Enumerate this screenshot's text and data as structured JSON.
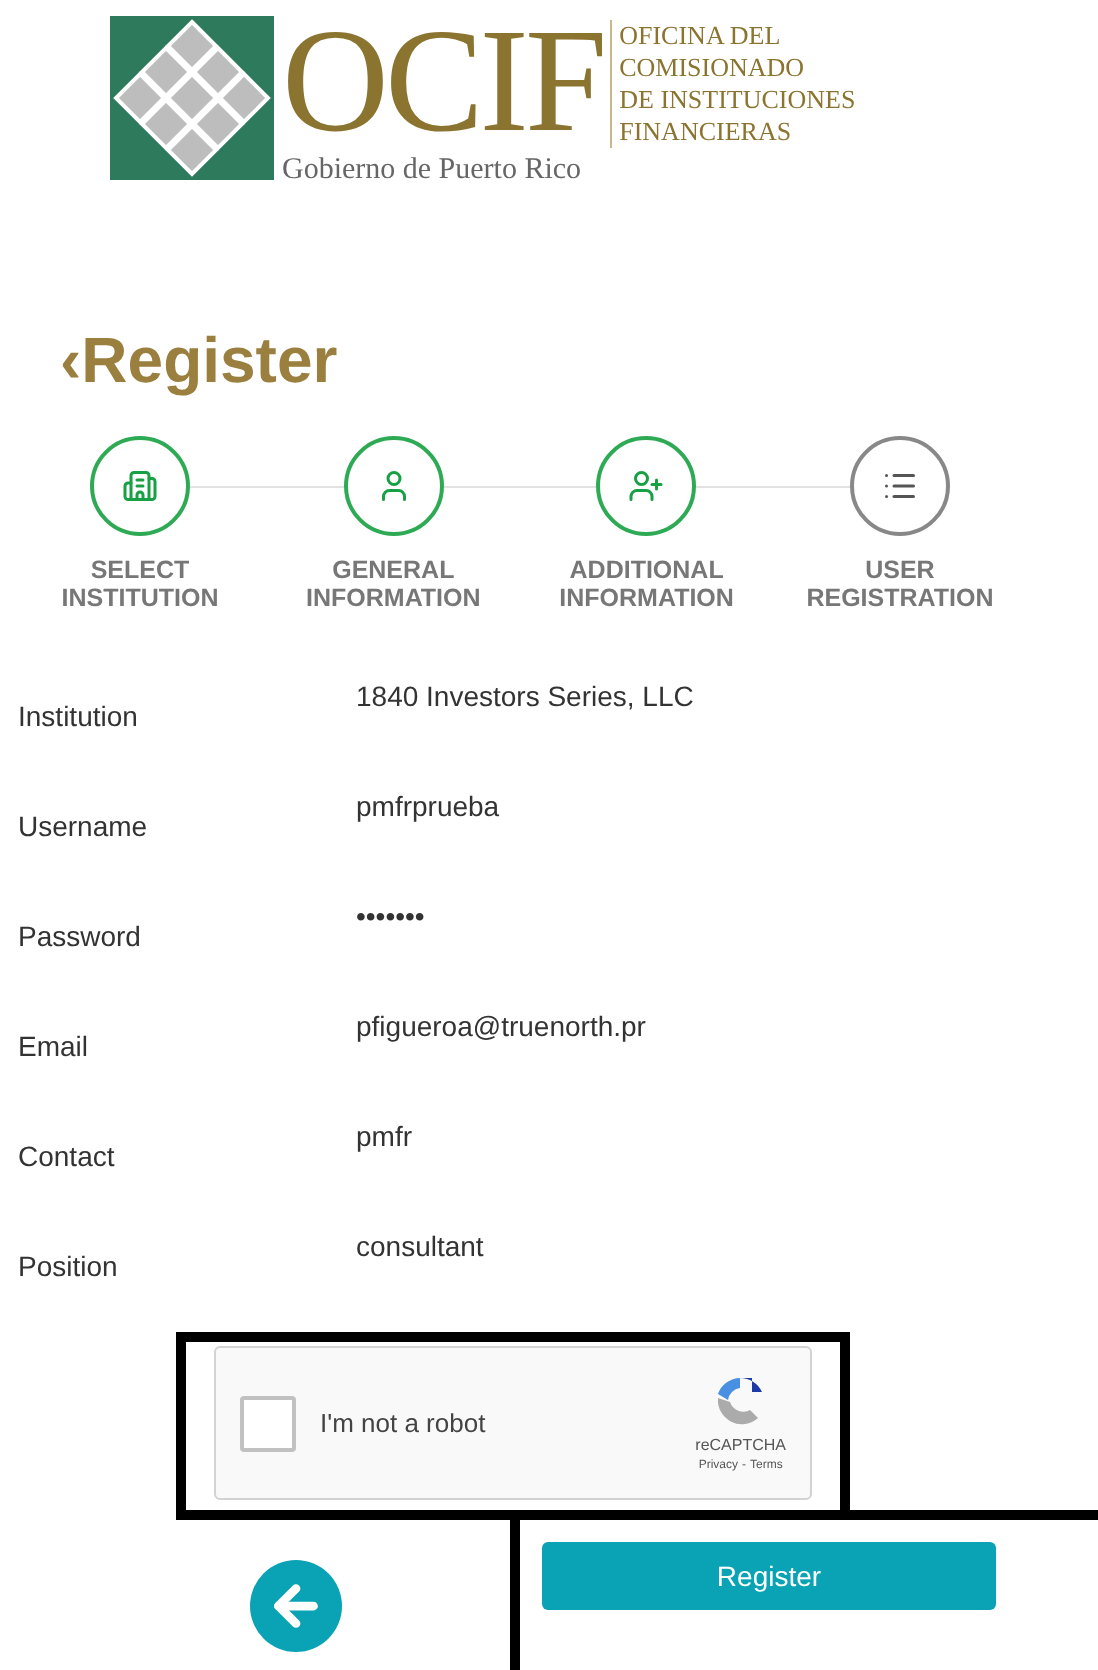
{
  "logo": {
    "letters": "OCIF",
    "subtitle": "Gobierno de Puerto Rico",
    "lines": [
      "OFICINA DEL",
      "COMISIONADO",
      "DE INSTITUCIONES",
      "FINANCIERAS"
    ]
  },
  "heading": {
    "back": "‹",
    "title": "Register"
  },
  "steps": [
    {
      "kind": "building",
      "label": "SELECT INSTITUTION",
      "done": true
    },
    {
      "kind": "user",
      "label": "GENERAL INFORMATION",
      "done": true
    },
    {
      "kind": "user-plus",
      "label": "ADDITIONAL INFORMATION",
      "done": true
    },
    {
      "kind": "list",
      "label": "USER REGISTRATION",
      "done": false
    }
  ],
  "fields": [
    {
      "label": "Institution",
      "value": "1840 Investors Series, LLC"
    },
    {
      "label": "Username",
      "value": "pmfrprueba"
    },
    {
      "label": "Password",
      "value": "•••••••"
    },
    {
      "label": "Email",
      "value": "pfigueroa@truenorth.pr"
    },
    {
      "label": "Contact",
      "value": "pmfr"
    },
    {
      "label": "Position",
      "value": "consultant"
    }
  ],
  "captcha": {
    "label": "I'm not a robot",
    "checked": false,
    "brand": "reCAPTCHA",
    "privacy": "Privacy",
    "separator": "-",
    "terms": "Terms"
  },
  "submit": "Register"
}
